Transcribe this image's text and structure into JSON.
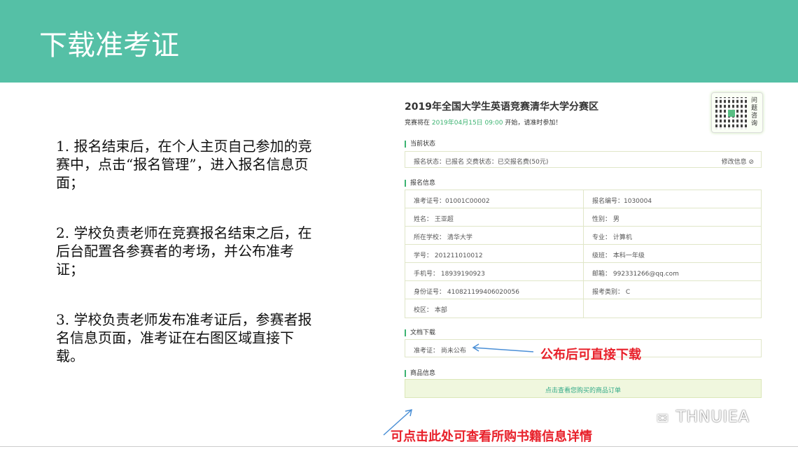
{
  "slide": {
    "title": "下载准考证",
    "steps": [
      "1. 报名结束后，在个人主页自己参加的竞赛中，点击“报名管理”，进入报名信息页面；",
      "2. 学校负责老师在竞赛报名结束之后，在后台配置各参赛者的考场，并公布准考证；",
      "3. 学校负责老师发布准考证后，参赛者报名信息页面，准考证在右图区域直接下载。"
    ]
  },
  "competition": {
    "title": "2019年全国大学生英语竞赛清华大学分赛区",
    "sub_prefix": "竞赛将在 ",
    "sub_date": "2019年04月15日 09:00",
    "sub_suffix": " 开始，请准时参加！",
    "qr_label": "问题咨询"
  },
  "status": {
    "section_label": "当前状态",
    "text": "报名状态：已报名     交费状态：已交报名费(50元)",
    "edit_label": "修改信息 ⊘"
  },
  "registration": {
    "section_label": "报名信息",
    "rows": [
      [
        "准考证号：01001C00002",
        "报名编号：1030004"
      ],
      [
        "姓名：  王亚超",
        "性别：  男"
      ],
      [
        "所在学校：  清华大学",
        "专业：  计算机"
      ],
      [
        "学号：  201211010012",
        "级班：  本科一年级"
      ],
      [
        "手机号：  18939190923",
        "邮箱：  992331266@qq.com"
      ],
      [
        "身份证号：  410821199406020056",
        "报考类别：  C"
      ],
      [
        "校区：  本部",
        ""
      ]
    ]
  },
  "download": {
    "section_label": "文档下载",
    "ticket_text": "准考证：  尚未公布"
  },
  "goods": {
    "section_label": "商品信息",
    "button_label": "点击查看您购买的商品订单"
  },
  "annotations": {
    "download_note": "公布后可直接下载",
    "goods_note": "可点击此处可查看所购书籍信息详情"
  },
  "watermark": "THNUIEA",
  "colors": {
    "header": "#55c0a6",
    "accent_green": "#3cb371",
    "note_red": "#e8202a",
    "arrow_blue": "#4a8fd6"
  }
}
